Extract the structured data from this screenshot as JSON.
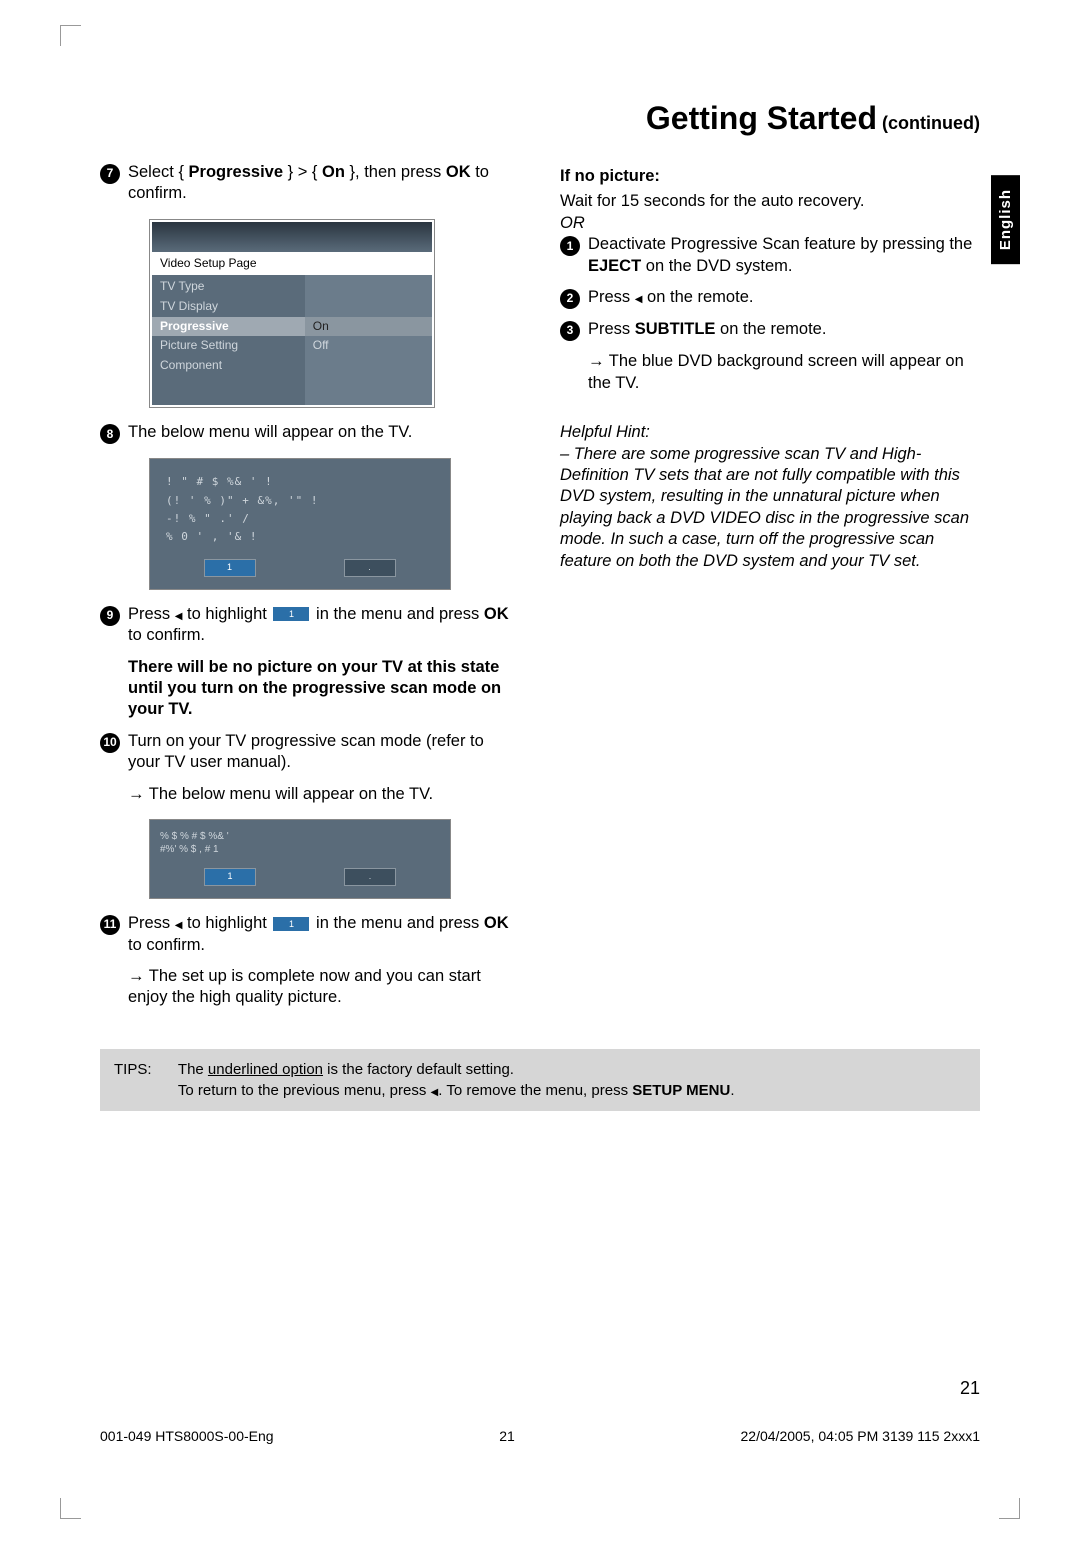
{
  "title": {
    "main": "Getting Started",
    "sub": " (continued)"
  },
  "side_tab": "English",
  "left": {
    "step7": {
      "num": "7",
      "text_pre": "Select { ",
      "prog": "Progressive",
      "text_mid": " } > { ",
      "on": "On",
      "text_post": " }, then press ",
      "ok": "OK",
      "tail": " to confirm."
    },
    "menu": {
      "header": "Video Setup Page",
      "items_left": [
        "TV Type",
        "TV Display",
        "Progressive",
        "Picture Setting",
        "Component"
      ],
      "items_right": [
        "On",
        "Off"
      ]
    },
    "step8": {
      "num": "8",
      "text": "The below menu will appear on the TV."
    },
    "sm1": {
      "lines": [
        "! \"   # $  %&  ' !",
        "(! ' % )\" + &%,  '\" !",
        "-! % \" .'       /",
        " % 0 ' ,   '& !"
      ],
      "btn_sel": "1",
      "btn_other": "."
    },
    "step9": {
      "num": "9",
      "text_a": "Press ",
      "text_b": " to highlight ",
      "text_c": " in the menu and press ",
      "ok": "OK",
      "text_d": " to confirm."
    },
    "warn": "There will be no picture on your TV at this state until you turn on the progressive scan mode on your TV.",
    "step10": {
      "num": "10",
      "text": "Turn on your TV progressive scan mode (refer to your TV user manual).",
      "arrow_text": "The below menu will appear on the TV."
    },
    "sm2": {
      "lines": [
        "  % $ %   # $  %&  '",
        "#%'  % $ , #   1"
      ],
      "btn_sel": "1",
      "btn_other": "."
    },
    "step11": {
      "num": "11",
      "text_a": "Press ",
      "text_b": " to highlight ",
      "text_c": " in the menu and press ",
      "ok": "OK",
      "text_d": " to confirm.",
      "arrow_text": "The set up is complete now and you can start enjoy the high quality picture."
    }
  },
  "right": {
    "if_no_pic": "If no picture:",
    "wait": "Wait for 15 seconds for the auto recovery.",
    "or": "OR",
    "step1": {
      "num": "1",
      "text_a": "Deactivate Progressive Scan feature by pressing the ",
      "eject": "EJECT",
      "text_b": " on the DVD system."
    },
    "step2": {
      "num": "2",
      "text_a": "Press ",
      "text_b": " on the remote."
    },
    "step3": {
      "num": "3",
      "text_a": "Press ",
      "subtitle": "SUBTITLE",
      "text_b": " on the remote.",
      "arrow_text": "The blue DVD background screen will appear on the TV."
    },
    "hints": {
      "label": "Helpful Hint:",
      "body": "– There are some progressive scan TV and High-Definition TV sets that are not fully compatible with this DVD system, resulting in the unnatural picture when playing back a DVD VIDEO disc in the progressive scan mode.  In such a case, turn off the progressive scan feature on both the DVD system and your TV set."
    }
  },
  "tips": {
    "label": "TIPS:",
    "line1a": "The ",
    "line1u": "underlined option",
    "line1b": " is the factory default setting.",
    "line2a": "To return to the previous menu, press ",
    "line2b": ".  To remove the menu, press ",
    "setup": "SETUP MENU",
    "line2c": "."
  },
  "pagenum": "21",
  "footer": {
    "left": "001-049 HTS8000S-00-Eng",
    "mid": "21",
    "right": "22/04/2005, 04:05 PM 3139 115 2xxx1"
  }
}
